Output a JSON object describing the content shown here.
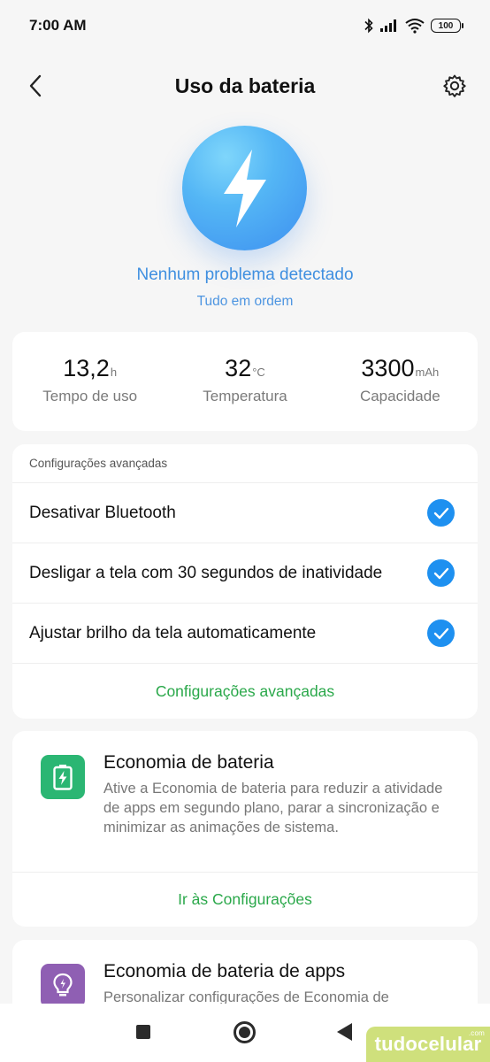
{
  "status_bar": {
    "time": "7:00 AM",
    "battery_level": "100",
    "icons": [
      "bluetooth-icon",
      "signal-icon",
      "wifi-icon",
      "battery-icon"
    ]
  },
  "header": {
    "title": "Uso da bateria",
    "back_icon": "chevron-left-icon",
    "settings_icon": "gear-icon"
  },
  "hero": {
    "icon": "lightning-bolt-icon",
    "title": "Nenhum problema detectado",
    "subtitle": "Tudo em ordem"
  },
  "stats": [
    {
      "value": "13,2",
      "unit": "h",
      "label": "Tempo de uso"
    },
    {
      "value": "32",
      "unit": "°C",
      "label": "Temperatura"
    },
    {
      "value": "3300",
      "unit": "mAh",
      "label": "Capacidade"
    }
  ],
  "advanced": {
    "header": "Configurações avançadas",
    "items": [
      {
        "label": "Desativar Bluetooth",
        "checked": true
      },
      {
        "label": "Desligar a tela com 30 segundos de inatividade",
        "checked": true
      },
      {
        "label": "Ajustar brilho da tela automaticamente",
        "checked": true
      }
    ],
    "link": "Configurações avançadas"
  },
  "battery_saver": {
    "icon": "battery-charging-icon",
    "title": "Economia de bateria",
    "description": "Ative a Economia de bateria para reduzir a atividade de apps em segundo plano, parar a sincronização e minimizar as animações de sistema.",
    "link": "Ir às Configurações"
  },
  "app_battery_saver": {
    "icon": "lightbulb-icon",
    "title": "Economia de bateria de apps",
    "description": "Personalizar configurações de Economia de"
  },
  "nav": {
    "recents_icon": "square-icon",
    "home_icon": "home-circle-icon",
    "back_icon": "back-triangle-icon"
  },
  "watermark": {
    "text": "tudocelular",
    "suffix": ".com"
  },
  "colors": {
    "accent_blue": "#3f8fe0",
    "link_green": "#2aa84a",
    "check_blue": "#1e90f0",
    "saver_green": "#2bb673",
    "apps_purple": "#8f5fb3"
  }
}
